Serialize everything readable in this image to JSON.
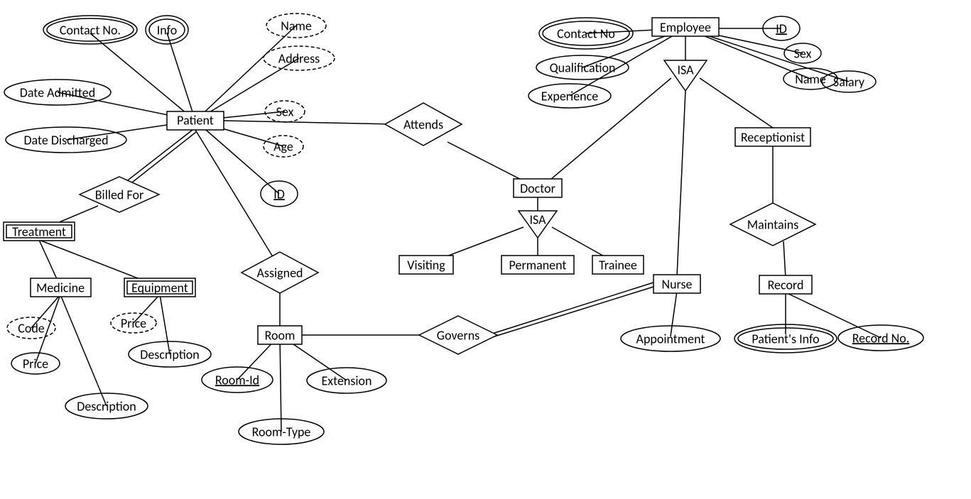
{
  "entities": {
    "patient": "Patient",
    "employee": "Employee",
    "doctor": "Doctor",
    "visiting": "Visiting",
    "permanent": "Permanent",
    "trainee": "Trainee",
    "nurse": "Nurse",
    "receptionist": "Receptionist",
    "record": "Record",
    "treatment": "Treatment",
    "medicine": "Medicine",
    "equipment": "Equipment",
    "room": "Room"
  },
  "attrs": {
    "contactNo": "Contact No.",
    "info": "Info",
    "name": "Name",
    "address": "Address",
    "dateAdm": "Date Admitted",
    "dateDis": "Date Discharged",
    "sex": "Sex",
    "age": "Age",
    "id": "ID",
    "empContact": "Contact No",
    "empId": "ID",
    "empSex": "Sex",
    "empName": "Name",
    "empSalary": "Salary",
    "qualification": "Qualification",
    "experience": "Experience",
    "code": "Code",
    "medPrice": "Price",
    "medDesc": "Description",
    "eqPrice": "Price",
    "eqDesc": "Description",
    "roomId": "Room-Id",
    "roomType": "Room-Type",
    "extension": "Extension",
    "appointment": "Appointment",
    "patientInfo": "Patient's Info",
    "recordNo": "Record No."
  },
  "rels": {
    "attends": "Attends",
    "billedFor": "Billed For",
    "assigned": "Assigned",
    "governs": "Governs",
    "maintains": "Maintains",
    "isa": "ISA"
  }
}
